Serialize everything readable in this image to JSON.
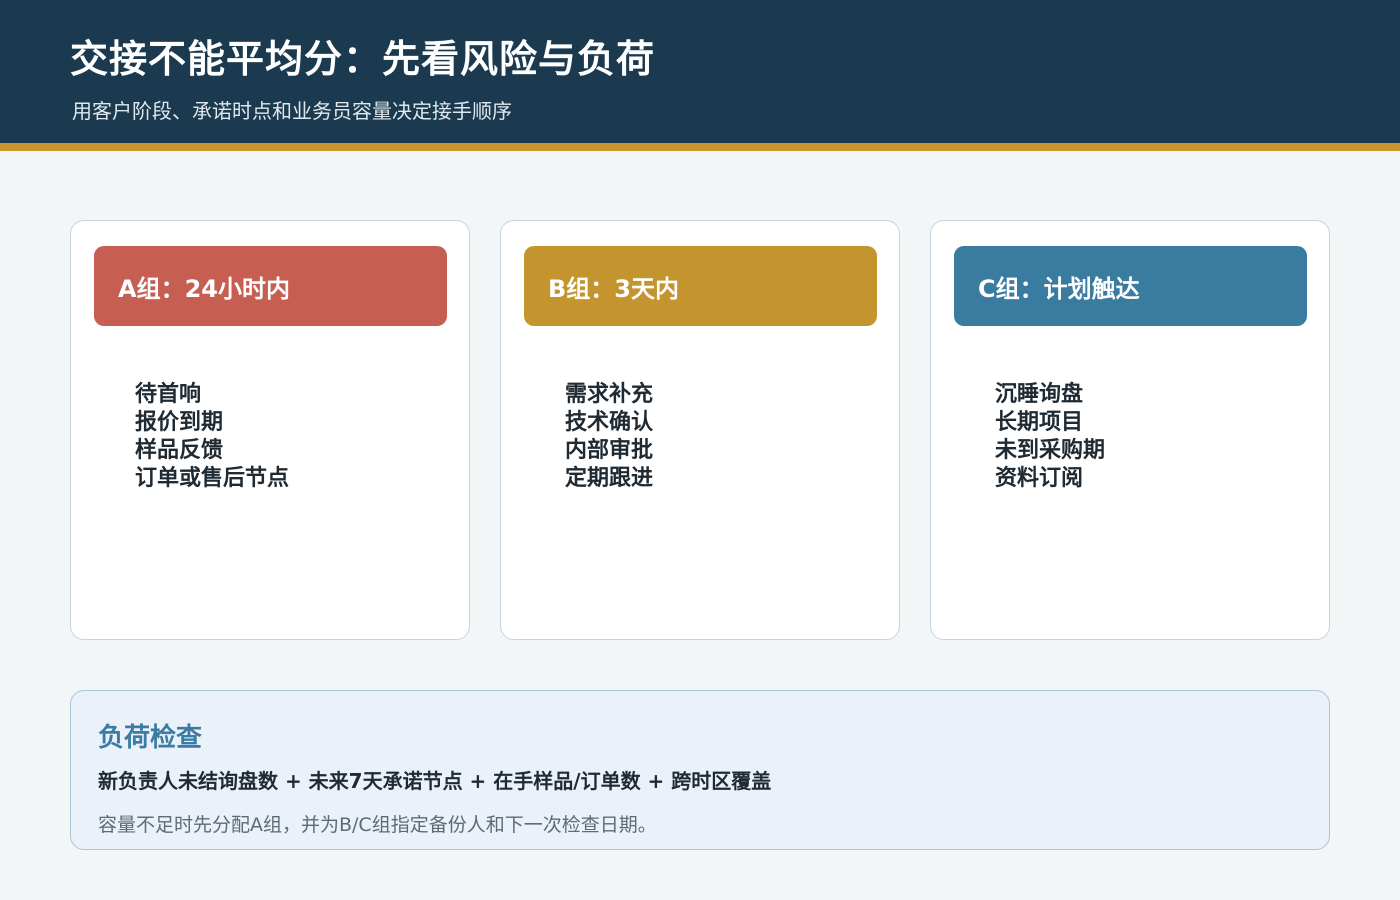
{
  "header": {
    "title": "交接不能平均分：先看风险与负荷",
    "subtitle": "用客户阶段、承诺时点和业务员容量决定接手顺序"
  },
  "colors": {
    "header_bg": "#1c3a4f",
    "accent_stripe": "#c8952f",
    "group_a": "#c65f52",
    "group_b": "#c4942f",
    "group_c": "#3a7ca0",
    "check_title": "#3a7ca5"
  },
  "groups": [
    {
      "title": "A组：24小时内",
      "items": [
        "待首响",
        "报价到期",
        "样品反馈",
        "订单或售后节点"
      ]
    },
    {
      "title": "B组：3天内",
      "items": [
        "需求补充",
        "技术确认",
        "内部审批",
        "定期跟进"
      ]
    },
    {
      "title": "C组：计划触达",
      "items": [
        "沉睡询盘",
        "长期项目",
        "未到采购期",
        "资料订阅"
      ]
    }
  ],
  "load_check": {
    "title": "负荷检查",
    "formula": "新负责人未结询盘数 + 未来7天承诺节点 + 在手样品/订单数 + 跨时区覆盖",
    "note": "容量不足时先分配A组，并为B/C组指定备份人和下一次检查日期。"
  }
}
